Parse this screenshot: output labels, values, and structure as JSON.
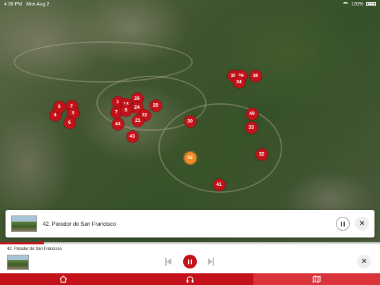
{
  "status_bar": {
    "time": "4:38 PM",
    "date": "Mon Aug 2",
    "battery": "100%"
  },
  "map": {
    "pins": [
      {
        "label": "2",
        "active": false
      },
      {
        "label": "3",
        "active": false
      },
      {
        "label": "4",
        "active": false
      },
      {
        "label": "5",
        "active": false
      },
      {
        "label": "6",
        "active": false
      },
      {
        "label": "1",
        "active": false
      },
      {
        "label": "14",
        "active": false
      },
      {
        "label": "26",
        "active": false
      },
      {
        "label": "24",
        "active": false
      },
      {
        "label": "7",
        "active": false
      },
      {
        "label": "8",
        "active": false
      },
      {
        "label": "22",
        "active": false
      },
      {
        "label": "21",
        "active": false
      },
      {
        "label": "44",
        "active": false
      },
      {
        "label": "29",
        "active": false
      },
      {
        "label": "30",
        "active": false
      },
      {
        "label": "43",
        "active": false
      },
      {
        "label": "35",
        "active": false
      },
      {
        "label": "36",
        "active": false
      },
      {
        "label": "38",
        "active": false
      },
      {
        "label": "34",
        "active": false
      },
      {
        "label": "40",
        "active": false
      },
      {
        "label": "33",
        "active": false
      },
      {
        "label": "32",
        "active": false
      },
      {
        "label": "42",
        "active": true
      },
      {
        "label": "41",
        "active": false
      }
    ]
  },
  "popup": {
    "title": "42. Parador de San Francisco"
  },
  "player": {
    "now_playing": "42. Parador de San Francisco",
    "progress_fraction": 0.11
  },
  "tabs": [
    {
      "name": "home",
      "icon": "home-icon",
      "selected": false
    },
    {
      "name": "audio",
      "icon": "headphones-icon",
      "selected": false
    },
    {
      "name": "map",
      "icon": "map-icon",
      "selected": true
    }
  ],
  "colors": {
    "accent": "#c4121b",
    "active_pin": "#f28c28"
  }
}
